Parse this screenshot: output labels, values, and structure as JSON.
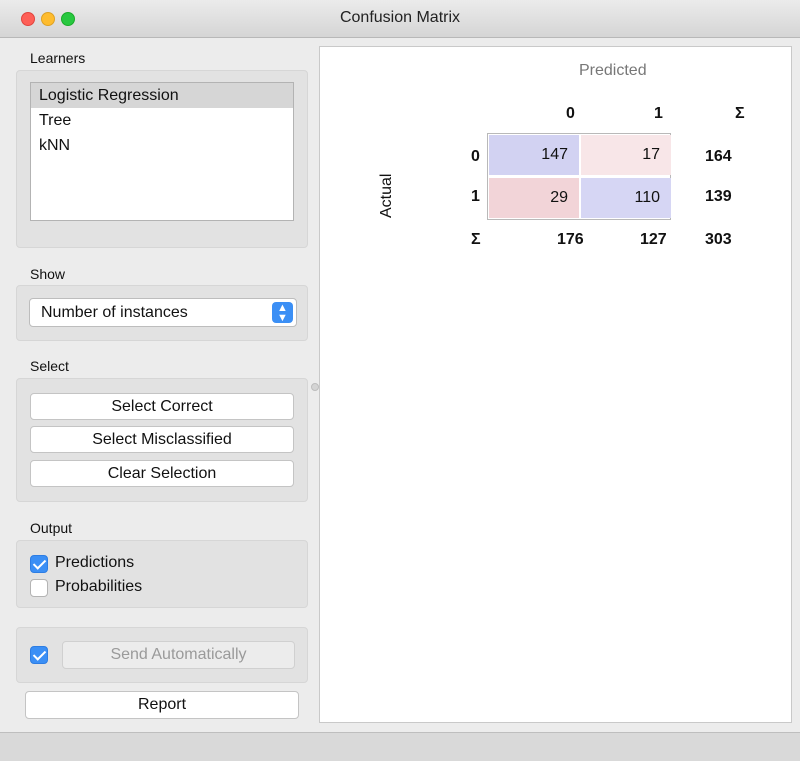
{
  "window": {
    "title": "Confusion Matrix"
  },
  "learners": {
    "label": "Learners",
    "items": [
      "Logistic Regression",
      "Tree",
      "kNN"
    ],
    "selected": "Logistic Regression"
  },
  "show": {
    "label": "Show",
    "selected": "Number of instances"
  },
  "select": {
    "label": "Select",
    "buttons": [
      "Select Correct",
      "Select Misclassified",
      "Clear Selection"
    ]
  },
  "output": {
    "label": "Output",
    "options": [
      {
        "label": "Predictions",
        "checked": true
      },
      {
        "label": "Probabilities",
        "checked": false
      }
    ]
  },
  "send": {
    "label": "Send Automatically",
    "checked": true
  },
  "report": {
    "label": "Report"
  },
  "matrix": {
    "predicted_label": "Predicted",
    "actual_label": "Actual",
    "col_headers": [
      "0",
      "1",
      "Σ"
    ],
    "row_headers": [
      "0",
      "1",
      "Σ"
    ],
    "cells": [
      [
        "147",
        "17"
      ],
      [
        "29",
        "110"
      ]
    ],
    "row_sums": [
      "164",
      "139"
    ],
    "col_sums": [
      "176",
      "127",
      "303"
    ],
    "colors": {
      "correct_strong": "#d2d2f2",
      "correct_medium": "#d6d6f4",
      "wrong_strong": "#f2d4d8",
      "wrong_light": "#f8e6e8"
    }
  }
}
